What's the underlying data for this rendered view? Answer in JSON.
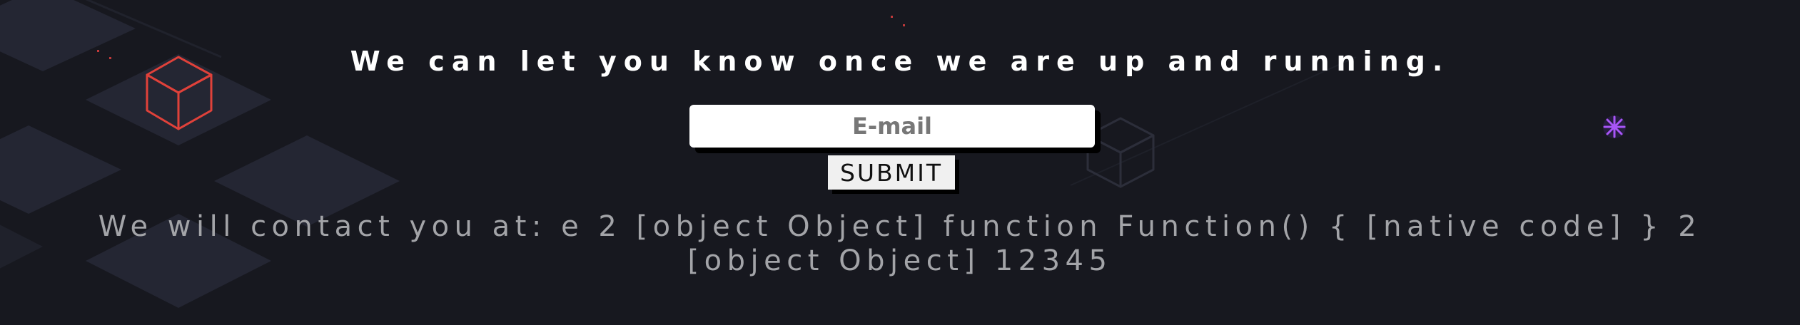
{
  "headline": "We can let you know once we are up and running.",
  "form": {
    "email_placeholder": "E-mail",
    "submit_label": "SUBMIT"
  },
  "contact": {
    "line1": "We will contact you at: e 2 [object Object] function Function() { [native code] } 2",
    "line2": "[object Object] 12345"
  },
  "colors": {
    "background": "#17181f",
    "tile": "#242633",
    "cube_outline": "#e0413a",
    "sparkle": "#a855f7",
    "contact_text": "#a3a4a8"
  }
}
